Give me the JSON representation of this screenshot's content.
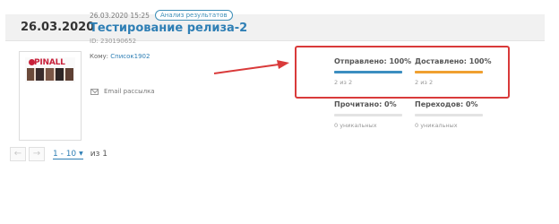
{
  "date_header": "26.03.2020",
  "campaign": {
    "datetime": "26.03.2020 15:25",
    "badge": "Анализ результатов",
    "title": "Тестирование релиза-2",
    "id_line": "ID: 230190652",
    "recipient_label": "Кому:",
    "recipient_list": "Список1902",
    "channel": "Email рассылка",
    "thumb_brand": "PINALL"
  },
  "stats": {
    "sent": {
      "label": "Отправлено: 100%",
      "sub": "2 из 2",
      "percent": 100,
      "color": "#3b8ec0"
    },
    "delivered": {
      "label": "Доставлено: 100%",
      "sub": "2 из 2",
      "percent": 100,
      "color": "#f0a030"
    },
    "opened": {
      "label": "Прочитано: 0%",
      "sub": "0 уникальных",
      "percent": 0,
      "color": "#3b8ec0"
    },
    "clicks": {
      "label": "Переходов: 0%",
      "sub": "0 уникальных",
      "percent": 0,
      "color": "#3b8ec0"
    }
  },
  "pagination": {
    "prev_icon": "arrow-left-icon",
    "next_icon": "arrow-right-icon",
    "range": "1 - 10",
    "of_text": "из 1"
  },
  "colors": {
    "accent": "#2f7fb5",
    "highlight": "#d93a3a"
  }
}
